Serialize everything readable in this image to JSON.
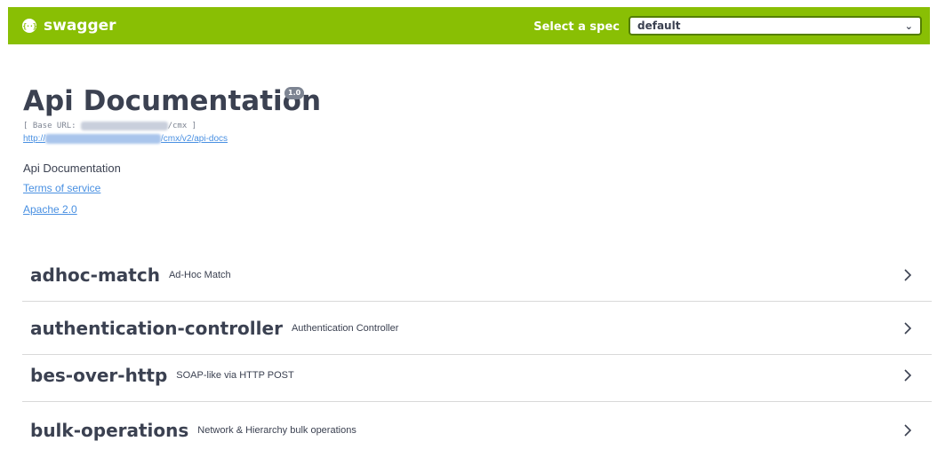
{
  "topbar": {
    "logo_text": "swagger",
    "logo_icon_glyph": "{··}",
    "spec_label": "Select a spec",
    "spec_selected": "default",
    "accent_color": "#89bf04"
  },
  "info": {
    "title": "Api Documentation",
    "version": "1.0",
    "base_url_prefix": "[ Base URL: ",
    "base_url_suffix": "/cmx ]",
    "docs_link_prefix": "http://",
    "docs_link_suffix": "/cmx/v2/api-docs",
    "description": "Api Documentation",
    "terms_label": "Terms of service",
    "license_label": "Apache 2.0"
  },
  "tags": [
    {
      "name": "adhoc-match",
      "description": "Ad-Hoc Match"
    },
    {
      "name": "authentication-controller",
      "description": "Authentication Controller"
    },
    {
      "name": "bes-over-http",
      "description": "SOAP-like via HTTP POST"
    },
    {
      "name": "bulk-operations",
      "description": "Network & Hierarchy bulk operations"
    }
  ]
}
